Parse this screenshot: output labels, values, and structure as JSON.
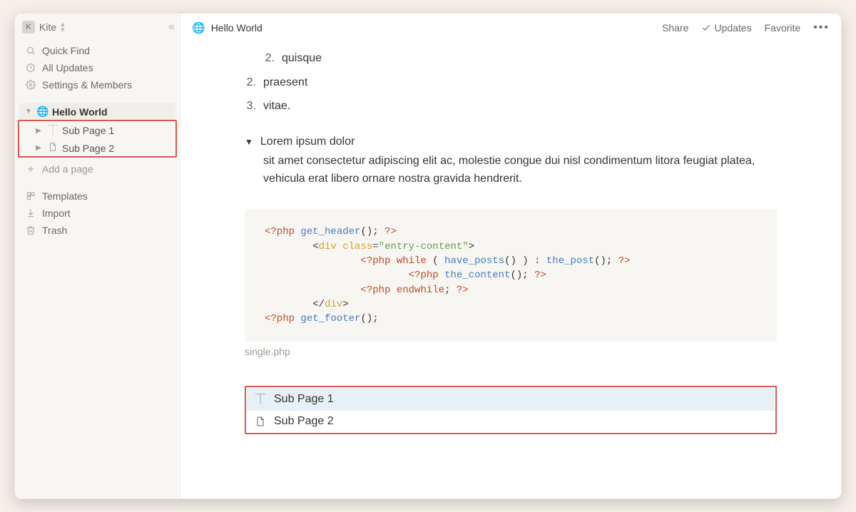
{
  "workspace": {
    "badge": "K",
    "name": "Kite"
  },
  "sidebar": {
    "quick_find": "Quick Find",
    "all_updates": "All Updates",
    "settings": "Settings & Members",
    "add_page": "Add a page",
    "templates": "Templates",
    "import": "Import",
    "trash": "Trash"
  },
  "tree": {
    "root": {
      "icon": "🌐",
      "label": "Hello World"
    },
    "children": [
      {
        "label": "Sub Page 1"
      },
      {
        "label": "Sub Page 2"
      }
    ]
  },
  "topbar": {
    "title": "Hello World",
    "share": "Share",
    "updates": "Updates",
    "favorite": "Favorite"
  },
  "body": {
    "ol_inner_2": "quisque",
    "ol_2": "praesent",
    "ol_3": "vitae.",
    "toggle_title": "Lorem ipsum dolor",
    "toggle_body": "sit amet consectetur adipiscing elit ac, molestie congue dui nisl condimentum litora feugiat platea, vehicula erat libero ornare nostra gravida hendrerit.",
    "code_caption": "single.php",
    "code": {
      "l1_fn": "get_header",
      "l2_class": "entry-content",
      "l3_fn1": "have_posts",
      "l3_fn2": "the_post",
      "l4_fn": "the_content",
      "l5_kw": "endwhile",
      "l7_fn": "get_footer"
    },
    "sub1": "Sub Page 1",
    "sub2": "Sub Page 2"
  }
}
